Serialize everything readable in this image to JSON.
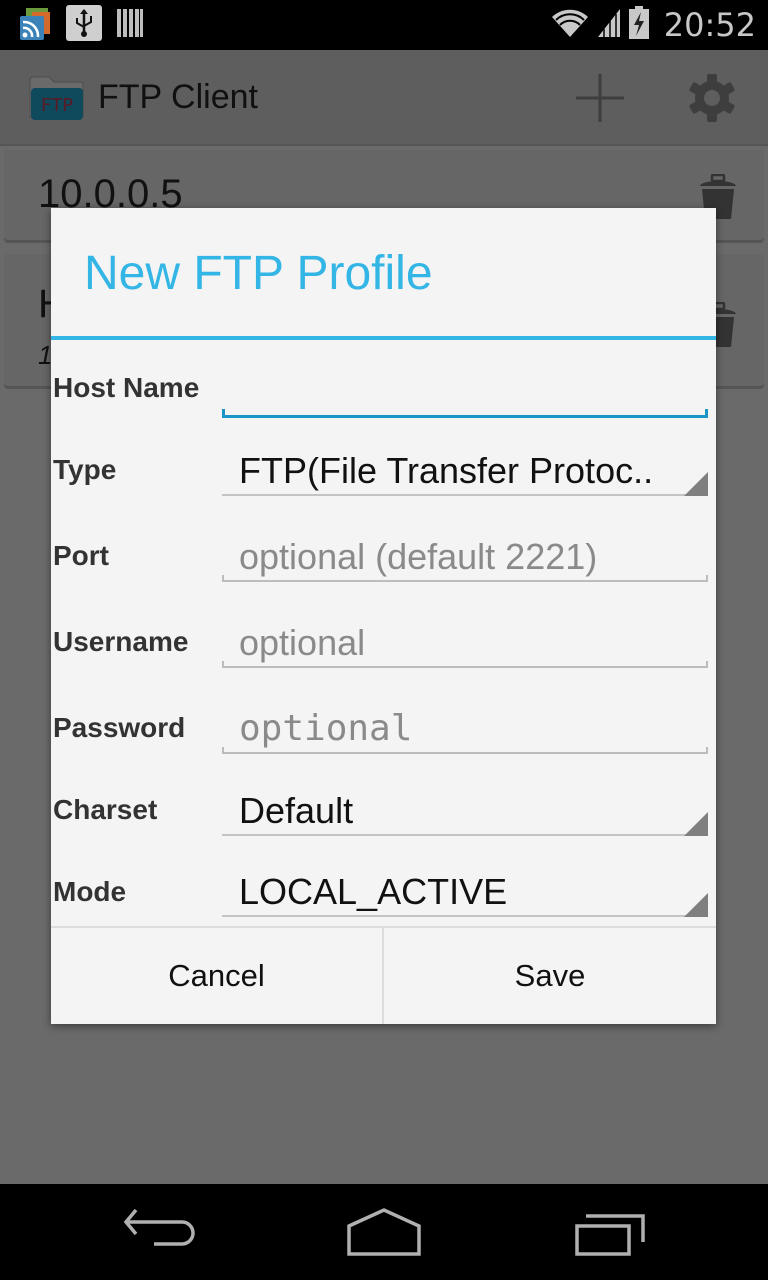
{
  "status_bar": {
    "notification_icons": [
      "rss-feed-icon",
      "usb-icon",
      "barcode-icon"
    ],
    "system_icons": [
      "wifi-icon",
      "cell-signal-icon",
      "battery-charging-icon"
    ],
    "time": "20:52"
  },
  "app": {
    "title": "FTP Client",
    "logo_text": "FTP",
    "actions": [
      "add-icon",
      "settings-icon"
    ],
    "profiles": [
      {
        "title": "10.0.0.5"
      },
      {
        "title": "H",
        "subtitle": "1"
      }
    ]
  },
  "dialog": {
    "title": "New FTP Profile",
    "accent_color": "#33b5e5",
    "fields": {
      "host_name": {
        "label": "Host Name",
        "value": "",
        "placeholder": ""
      },
      "type": {
        "label": "Type",
        "value": "FTP(File Transfer Protoc.."
      },
      "port": {
        "label": "Port",
        "value": "",
        "placeholder": "optional (default 2221)"
      },
      "username": {
        "label": "Username",
        "value": "",
        "placeholder": "optional"
      },
      "password": {
        "label": "Password",
        "value": "",
        "placeholder": "optional"
      },
      "charset": {
        "label": "Charset",
        "value": "Default"
      },
      "mode": {
        "label": "Mode",
        "value": "LOCAL_ACTIVE"
      }
    },
    "buttons": {
      "cancel": "Cancel",
      "save": "Save"
    }
  },
  "nav_bar": {
    "buttons": [
      "back",
      "home",
      "recent-apps"
    ]
  }
}
